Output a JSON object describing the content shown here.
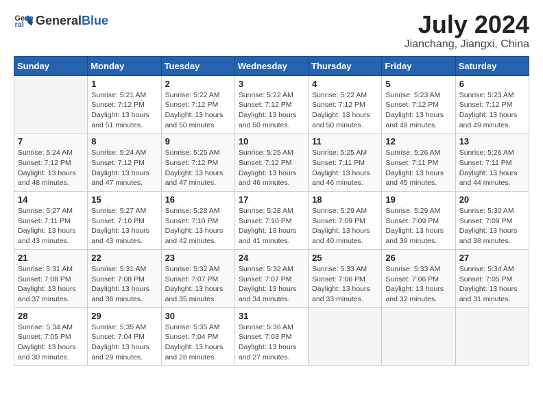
{
  "header": {
    "logo_general": "General",
    "logo_blue": "Blue",
    "title": "July 2024",
    "location": "Jianchang, Jiangxi, China"
  },
  "calendar": {
    "weekdays": [
      "Sunday",
      "Monday",
      "Tuesday",
      "Wednesday",
      "Thursday",
      "Friday",
      "Saturday"
    ],
    "weeks": [
      [
        {
          "day": "",
          "info": ""
        },
        {
          "day": "1",
          "info": "Sunrise: 5:21 AM\nSunset: 7:12 PM\nDaylight: 13 hours\nand 51 minutes."
        },
        {
          "day": "2",
          "info": "Sunrise: 5:22 AM\nSunset: 7:12 PM\nDaylight: 13 hours\nand 50 minutes."
        },
        {
          "day": "3",
          "info": "Sunrise: 5:22 AM\nSunset: 7:12 PM\nDaylight: 13 hours\nand 50 minutes."
        },
        {
          "day": "4",
          "info": "Sunrise: 5:22 AM\nSunset: 7:12 PM\nDaylight: 13 hours\nand 50 minutes."
        },
        {
          "day": "5",
          "info": "Sunrise: 5:23 AM\nSunset: 7:12 PM\nDaylight: 13 hours\nand 49 minutes."
        },
        {
          "day": "6",
          "info": "Sunrise: 5:23 AM\nSunset: 7:12 PM\nDaylight: 13 hours\nand 49 minutes."
        }
      ],
      [
        {
          "day": "7",
          "info": "Sunrise: 5:24 AM\nSunset: 7:12 PM\nDaylight: 13 hours\nand 48 minutes."
        },
        {
          "day": "8",
          "info": "Sunrise: 5:24 AM\nSunset: 7:12 PM\nDaylight: 13 hours\nand 47 minutes."
        },
        {
          "day": "9",
          "info": "Sunrise: 5:25 AM\nSunset: 7:12 PM\nDaylight: 13 hours\nand 47 minutes."
        },
        {
          "day": "10",
          "info": "Sunrise: 5:25 AM\nSunset: 7:12 PM\nDaylight: 13 hours\nand 46 minutes."
        },
        {
          "day": "11",
          "info": "Sunrise: 5:25 AM\nSunset: 7:11 PM\nDaylight: 13 hours\nand 46 minutes."
        },
        {
          "day": "12",
          "info": "Sunrise: 5:26 AM\nSunset: 7:11 PM\nDaylight: 13 hours\nand 45 minutes."
        },
        {
          "day": "13",
          "info": "Sunrise: 5:26 AM\nSunset: 7:11 PM\nDaylight: 13 hours\nand 44 minutes."
        }
      ],
      [
        {
          "day": "14",
          "info": "Sunrise: 5:27 AM\nSunset: 7:11 PM\nDaylight: 13 hours\nand 43 minutes."
        },
        {
          "day": "15",
          "info": "Sunrise: 5:27 AM\nSunset: 7:10 PM\nDaylight: 13 hours\nand 43 minutes."
        },
        {
          "day": "16",
          "info": "Sunrise: 5:28 AM\nSunset: 7:10 PM\nDaylight: 13 hours\nand 42 minutes."
        },
        {
          "day": "17",
          "info": "Sunrise: 5:28 AM\nSunset: 7:10 PM\nDaylight: 13 hours\nand 41 minutes."
        },
        {
          "day": "18",
          "info": "Sunrise: 5:29 AM\nSunset: 7:09 PM\nDaylight: 13 hours\nand 40 minutes."
        },
        {
          "day": "19",
          "info": "Sunrise: 5:29 AM\nSunset: 7:09 PM\nDaylight: 13 hours\nand 39 minutes."
        },
        {
          "day": "20",
          "info": "Sunrise: 5:30 AM\nSunset: 7:09 PM\nDaylight: 13 hours\nand 38 minutes."
        }
      ],
      [
        {
          "day": "21",
          "info": "Sunrise: 5:31 AM\nSunset: 7:08 PM\nDaylight: 13 hours\nand 37 minutes."
        },
        {
          "day": "22",
          "info": "Sunrise: 5:31 AM\nSunset: 7:08 PM\nDaylight: 13 hours\nand 36 minutes."
        },
        {
          "day": "23",
          "info": "Sunrise: 5:32 AM\nSunset: 7:07 PM\nDaylight: 13 hours\nand 35 minutes."
        },
        {
          "day": "24",
          "info": "Sunrise: 5:32 AM\nSunset: 7:07 PM\nDaylight: 13 hours\nand 34 minutes."
        },
        {
          "day": "25",
          "info": "Sunrise: 5:33 AM\nSunset: 7:06 PM\nDaylight: 13 hours\nand 33 minutes."
        },
        {
          "day": "26",
          "info": "Sunrise: 5:33 AM\nSunset: 7:06 PM\nDaylight: 13 hours\nand 32 minutes."
        },
        {
          "day": "27",
          "info": "Sunrise: 5:34 AM\nSunset: 7:05 PM\nDaylight: 13 hours\nand 31 minutes."
        }
      ],
      [
        {
          "day": "28",
          "info": "Sunrise: 5:34 AM\nSunset: 7:05 PM\nDaylight: 13 hours\nand 30 minutes."
        },
        {
          "day": "29",
          "info": "Sunrise: 5:35 AM\nSunset: 7:04 PM\nDaylight: 13 hours\nand 29 minutes."
        },
        {
          "day": "30",
          "info": "Sunrise: 5:35 AM\nSunset: 7:04 PM\nDaylight: 13 hours\nand 28 minutes."
        },
        {
          "day": "31",
          "info": "Sunrise: 5:36 AM\nSunset: 7:03 PM\nDaylight: 13 hours\nand 27 minutes."
        },
        {
          "day": "",
          "info": ""
        },
        {
          "day": "",
          "info": ""
        },
        {
          "day": "",
          "info": ""
        }
      ]
    ]
  }
}
